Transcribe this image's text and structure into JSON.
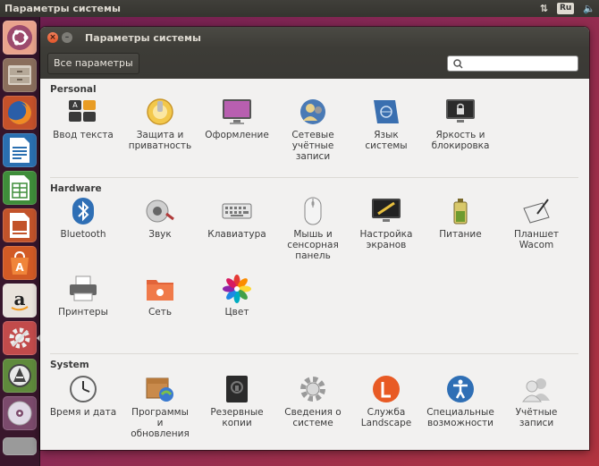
{
  "top_panel": {
    "title": "Параметры системы",
    "keyboard_layout": "Ru"
  },
  "window": {
    "title": "Параметры системы",
    "close_glyph": "×",
    "minimize_glyph": "–"
  },
  "toolbar": {
    "all_settings": "Все параметры",
    "search_placeholder": ""
  },
  "sections": {
    "personal": {
      "title": "Personal",
      "items": [
        {
          "label": "Ввод текста",
          "icon": "keyboard-input-icon"
        },
        {
          "label": "Защита и\nприватность",
          "icon": "privacy-icon"
        },
        {
          "label": "Оформление",
          "icon": "appearance-icon"
        },
        {
          "label": "Сетевые\nучётные\nзаписи",
          "icon": "online-accounts-icon"
        },
        {
          "label": "Язык\nсистемы",
          "icon": "language-icon"
        },
        {
          "label": "Яркость и\nблокировка",
          "icon": "brightness-lock-icon"
        }
      ]
    },
    "hardware": {
      "title": "Hardware",
      "items": [
        {
          "label": "Bluetooth",
          "icon": "bluetooth-icon"
        },
        {
          "label": "Звук",
          "icon": "sound-icon"
        },
        {
          "label": "Клавиатура",
          "icon": "keyboard-icon"
        },
        {
          "label": "Мышь и\nсенсорная\nпанель",
          "icon": "mouse-icon"
        },
        {
          "label": "Настройка\nэкранов",
          "icon": "displays-icon"
        },
        {
          "label": "Питание",
          "icon": "power-icon"
        },
        {
          "label": "Планшет\nWacom",
          "icon": "wacom-icon"
        },
        {
          "label": "Принтеры",
          "icon": "printer-icon"
        },
        {
          "label": "Сеть",
          "icon": "network-icon"
        },
        {
          "label": "Цвет",
          "icon": "color-icon"
        }
      ]
    },
    "system": {
      "title": "System",
      "items": [
        {
          "label": "Время и дата",
          "icon": "clock-icon"
        },
        {
          "label": "Программы\nи\nобновления",
          "icon": "software-updates-icon"
        },
        {
          "label": "Резервные\nкопии",
          "icon": "backup-icon"
        },
        {
          "label": "Сведения о\nсистеме",
          "icon": "system-info-icon"
        },
        {
          "label": "Служба\nLandscape",
          "icon": "landscape-icon"
        },
        {
          "label": "Специальные\nвозможности",
          "icon": "accessibility-icon"
        },
        {
          "label": "Учётные\nзаписи",
          "icon": "user-accounts-icon"
        }
      ]
    }
  },
  "launcher": [
    {
      "name": "ubuntu-dash-icon"
    },
    {
      "name": "files-icon"
    },
    {
      "name": "firefox-icon"
    },
    {
      "name": "libreoffice-writer-icon"
    },
    {
      "name": "libreoffice-calc-icon"
    },
    {
      "name": "libreoffice-impress-icon"
    },
    {
      "name": "software-center-icon"
    },
    {
      "name": "amazon-icon"
    },
    {
      "name": "system-settings-icon"
    },
    {
      "name": "software-updater-icon"
    },
    {
      "name": "dvd-icon"
    }
  ]
}
